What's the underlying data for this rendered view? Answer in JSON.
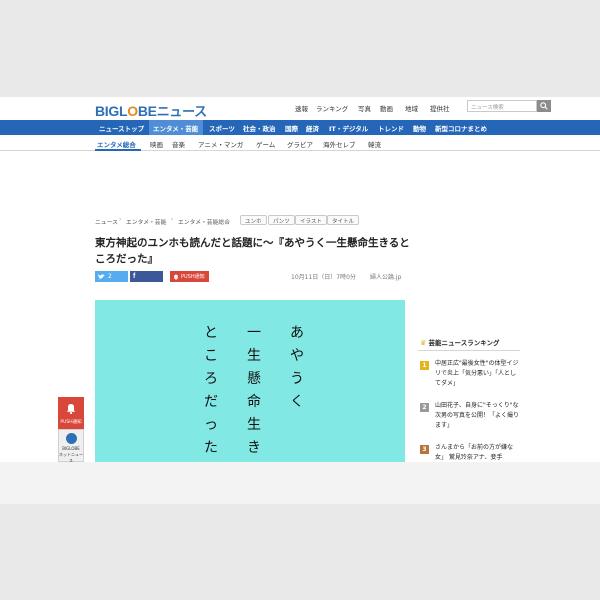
{
  "header": {
    "logo": {
      "part1": "BIGL",
      "part2": "O",
      "part3": "BE",
      "suffix": "ニュース"
    },
    "utility_links": [
      "速報",
      "ランキング",
      "写真",
      "動画",
      "地域",
      "提供社"
    ],
    "search_placeholder": "ニュース検索"
  },
  "main_nav": [
    "ニューストップ",
    "エンタメ・芸能",
    "スポーツ",
    "社会・政治",
    "国際",
    "経済",
    "IT・デジタル",
    "トレンド",
    "動物",
    "新型コロナまとめ"
  ],
  "main_nav_active": "エンタメ・芸能",
  "sub_nav": [
    "エンタメ総合",
    "映画",
    "音楽",
    "アニメ・マンガ",
    "ゲーム",
    "グラビア",
    "海外セレブ",
    "韓流"
  ],
  "breadcrumb": [
    "ニュース",
    "エンタメ・芸能",
    "エンタメ・芸能総合"
  ],
  "tags": [
    "ユンホ",
    "パンツ",
    "イラスト",
    "タイトル"
  ],
  "article": {
    "title": "東方神起のユンホも読んだと話題に〜『あやうく一生懸命生きるところだった』",
    "date": "10月11日（日）7時0分",
    "source": "婦人公論.jp",
    "share": {
      "twitter_count": "2",
      "push_label": "PUSH通知"
    },
    "hero_columns": [
      "あやうく",
      "一生懸命生きる",
      "ところだった"
    ],
    "hero_color": "#81e8e4"
  },
  "ranking": {
    "heading": "芸能ニュースランキング",
    "items": [
      {
        "rank": "1",
        "text": "中居正広\"最後女性\"の体型イジリで炎上「気分悪い」「人としてダメ」",
        "color": "#e6b320"
      },
      {
        "rank": "2",
        "text": "山田花子、自身に\"そっくり\"な次男の写真を公開！「よく撮ります」",
        "color": "#9a9a9a"
      },
      {
        "rank": "3",
        "text": "さんまから「お前の方が嫌な女」 鷲見玲奈アナ、妾手",
        "color": "#b8743a"
      }
    ]
  },
  "push_widget": {
    "red_label": "PUSH通知",
    "gray_label_1": "BIGLOBE",
    "gray_label_2": "ネットニュース"
  },
  "colors": {
    "nav_blue": "#2666b8",
    "nav_active": "#4f8ed6",
    "logo_blue": "#2f6fb7",
    "logo_orange": "#e58a17",
    "push_red": "#d9473b"
  }
}
